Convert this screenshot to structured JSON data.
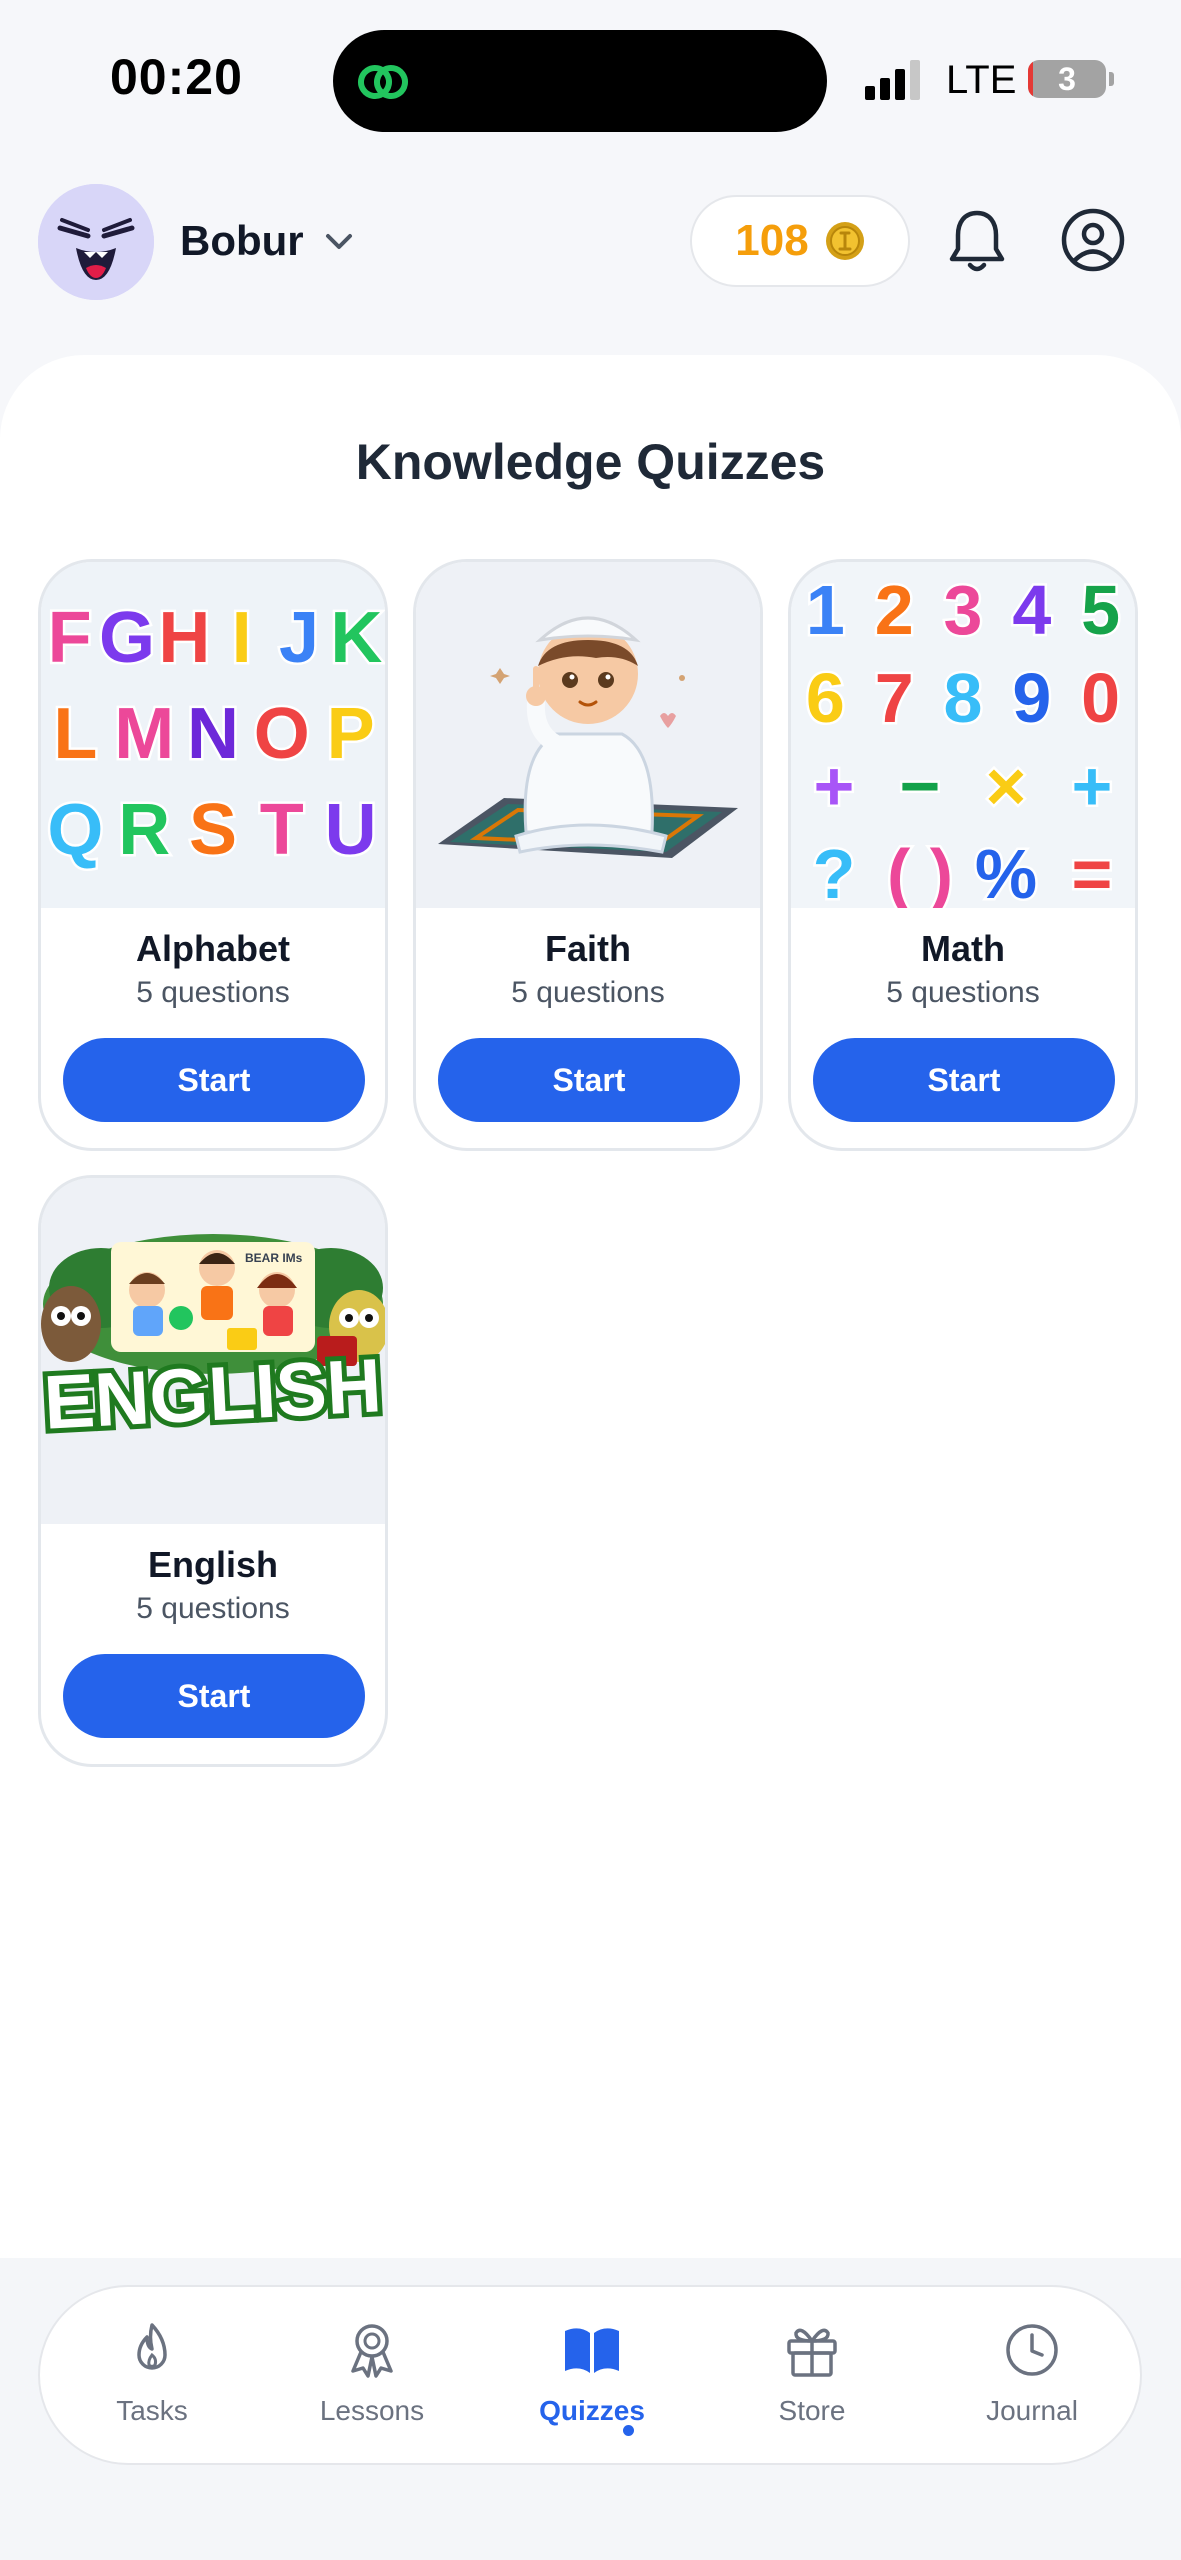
{
  "status_bar": {
    "time": "00:20",
    "network": "LTE",
    "battery": "3"
  },
  "header": {
    "username": "Bobur",
    "coins": "108",
    "icons": {
      "avatar": "laughing-face-avatar",
      "dropdown": "chevron-down-icon",
      "coin": "gold-coin-icon",
      "notifications": "bell-icon",
      "profile": "user-circle-icon"
    }
  },
  "main": {
    "title": "Knowledge Quizzes",
    "quizzes": [
      {
        "title": "Alphabet",
        "questions": "5 questions",
        "start_label": "Start",
        "image": "colorful-alphabet-letters"
      },
      {
        "title": "Faith",
        "questions": "5 questions",
        "start_label": "Start",
        "image": "boy-praying-on-rug"
      },
      {
        "title": "Math",
        "questions": "5 questions",
        "start_label": "Start",
        "image": "colorful-number-characters"
      },
      {
        "title": "English",
        "questions": "5 questions",
        "start_label": "Start",
        "image": "english-kids-illustration"
      }
    ],
    "english_image_text": "ENGLISH"
  },
  "alphabet_letters": [
    "F",
    "G",
    "H",
    "I",
    "J",
    "K",
    "L",
    "M",
    "N",
    "O",
    "P",
    "Q",
    "R",
    "S",
    "T",
    "U"
  ],
  "math_symbols": [
    "1",
    "2",
    "3",
    "4",
    "5",
    "6",
    "7",
    "8",
    "9",
    "0",
    "+",
    "−",
    "×",
    "+",
    "?",
    "( )",
    "%",
    "="
  ],
  "bottom_nav": {
    "items": [
      {
        "label": "Tasks",
        "icon": "flame-icon",
        "active": false
      },
      {
        "label": "Lessons",
        "icon": "award-ribbon-icon",
        "active": false
      },
      {
        "label": "Quizzes",
        "icon": "open-book-icon",
        "active": true
      },
      {
        "label": "Store",
        "icon": "gift-icon",
        "active": false
      },
      {
        "label": "Journal",
        "icon": "clock-icon",
        "active": false
      }
    ]
  },
  "colors": {
    "primary": "#2563eb",
    "coin": "#f59e0b",
    "background": "#f6f7fa",
    "card_border": "#e3e7ec"
  }
}
